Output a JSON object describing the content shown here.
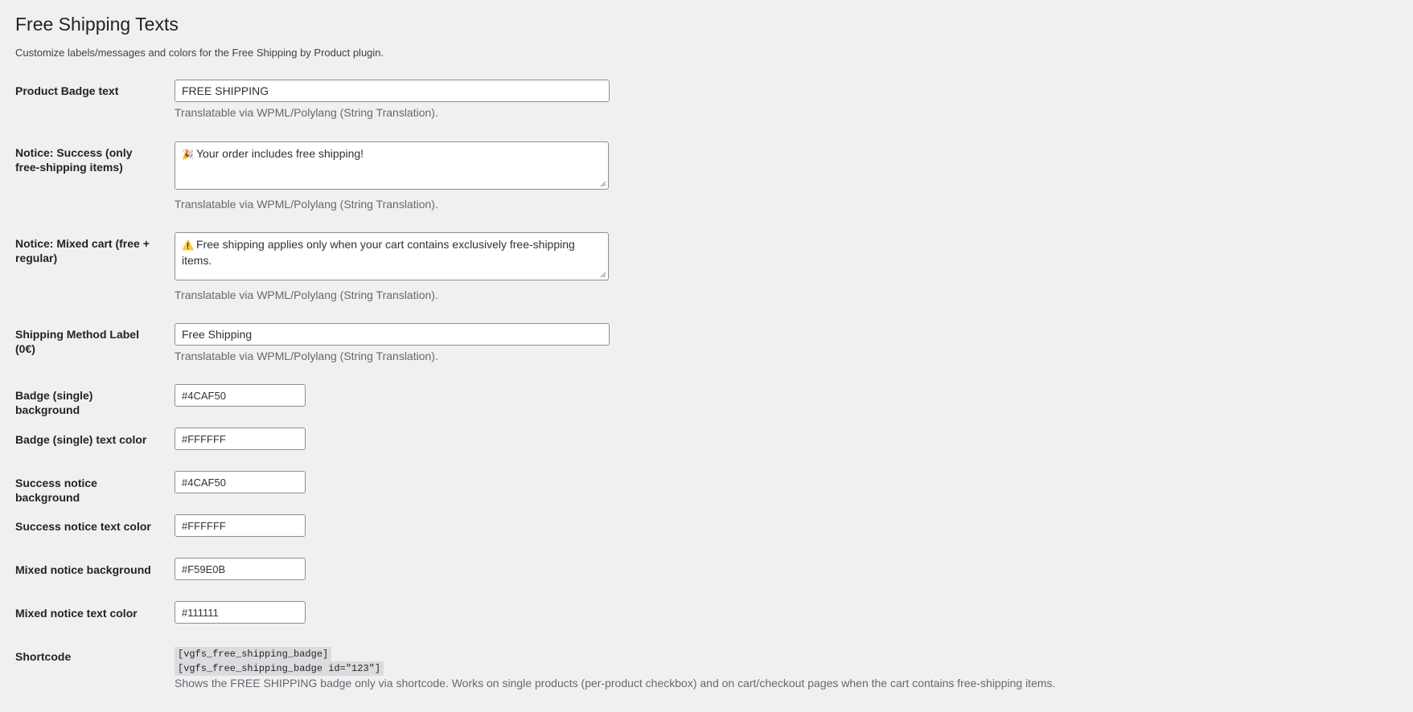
{
  "page": {
    "title": "Free Shipping Texts",
    "description": "Customize labels/messages and colors for the Free Shipping by Product plugin."
  },
  "fields": {
    "product_badge": {
      "label": "Product Badge text",
      "value": "FREE SHIPPING",
      "help": "Translatable via WPML/Polylang (String Translation)."
    },
    "notice_success": {
      "label": "Notice: Success (only free-shipping items)",
      "emoji": "🎉",
      "value": "Your order includes free shipping!",
      "help": "Translatable via WPML/Polylang (String Translation)."
    },
    "notice_mixed": {
      "label": "Notice: Mixed cart (free + regular)",
      "emoji": "⚠️",
      "value": "Free shipping applies only when your cart contains exclusively free-shipping items.",
      "help": "Translatable via WPML/Polylang (String Translation)."
    },
    "shipping_label": {
      "label": "Shipping Method Label (0€)",
      "value": "Free Shipping",
      "help": "Translatable via WPML/Polylang (String Translation)."
    },
    "badge_bg": {
      "label": "Badge (single) background",
      "value": "#4CAF50"
    },
    "badge_text": {
      "label": "Badge (single) text color",
      "value": "#FFFFFF"
    },
    "success_bg": {
      "label": "Success notice background",
      "value": "#4CAF50"
    },
    "success_text": {
      "label": "Success notice text color",
      "value": "#FFFFFF"
    },
    "mixed_bg": {
      "label": "Mixed notice background",
      "value": "#F59E0B"
    },
    "mixed_text": {
      "label": "Mixed notice text color",
      "value": "#111111"
    },
    "shortcode": {
      "label": "Shortcode",
      "code1": "[vgfs_free_shipping_badge]",
      "code2": "[vgfs_free_shipping_badge id=\"123\"]",
      "help": "Shows the FREE SHIPPING badge only via shortcode. Works on single products (per-product checkbox) and on cart/checkout pages when the cart contains free-shipping items."
    }
  }
}
